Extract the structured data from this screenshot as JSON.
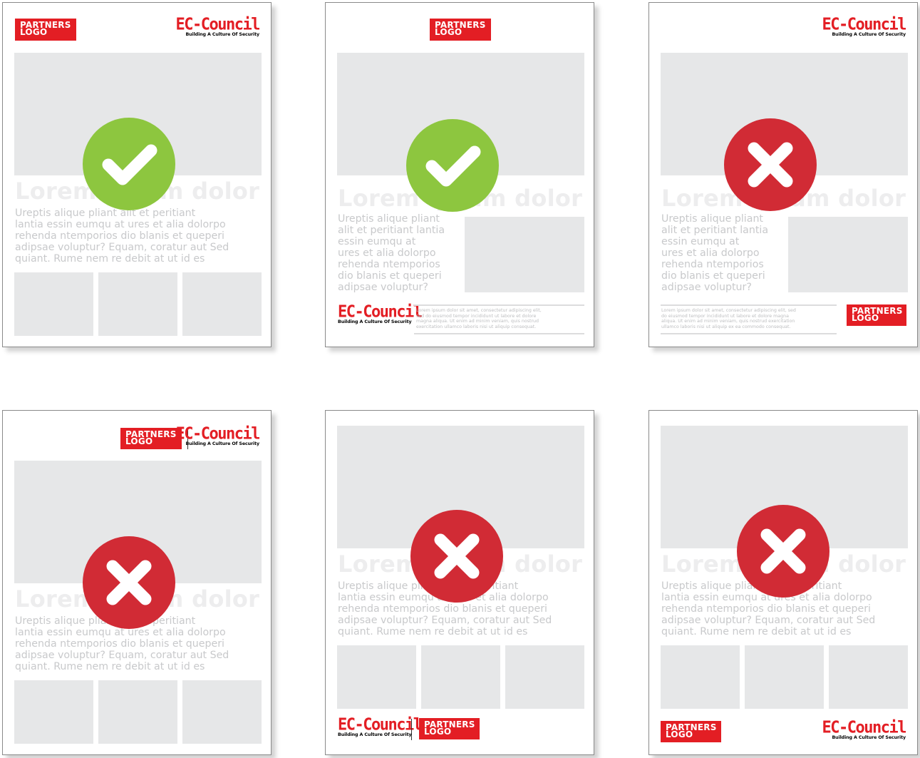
{
  "partners_logo": {
    "line1": "PARTNERS",
    "line2": "LOGO"
  },
  "ec_logo": {
    "name": "EC-Council",
    "tagline": "Building A Culture Of Security"
  },
  "headline": "Lorem ipsum dolor",
  "body_wide": "Ureptis alique pliant alit et peritiant\nlantia  essin eumqu at ures et alia dolorpo\nrehenda ntemporios dio blanis et queperi\nadipsae voluptur? Equam, coratur aut Sed\nquiant. Rume nem re debit at ut id es",
  "body_narrow": "Ureptis alique pliant\nalit et peritiant lantia\nessin eumqu at\nures et alia dolorpo\nrehenda ntemporios\ndio blanis et queperi\nadipsae voluptur?",
  "fine_print_a": "Lorem ipsum dolor sit amet, consectetur adipiscing elit,\nsed do eiusmod tempor incididunt ut labore et dolore\nmagna aliqua. Ut enim ad minim veniam, quis nostrud\nexercitation ullamco laboris nisi ut aliquip consequat.",
  "fine_print_b": "Lorem ipsum dolor sit amet, consectetur adipiscing elit, sed\ndo eiusmod tempor incididunt ut labore et dolore magna\naliqua. Ut enim ad minim veniam, quis nostrud exercitation\nullamco laboris nisi ut aliquip ex ea commodo consequat.",
  "colors": {
    "brand_red": "#e31e24",
    "ok_green": "#8dc63f",
    "no_red": "#d12b35",
    "placeholder": "#e6e7e8"
  },
  "examples": [
    {
      "verdict": "correct",
      "icon": "check-icon"
    },
    {
      "verdict": "correct",
      "icon": "check-icon"
    },
    {
      "verdict": "incorrect",
      "icon": "cross-icon"
    },
    {
      "verdict": "incorrect",
      "icon": "cross-icon"
    },
    {
      "verdict": "incorrect",
      "icon": "cross-icon"
    },
    {
      "verdict": "incorrect",
      "icon": "cross-icon"
    }
  ]
}
